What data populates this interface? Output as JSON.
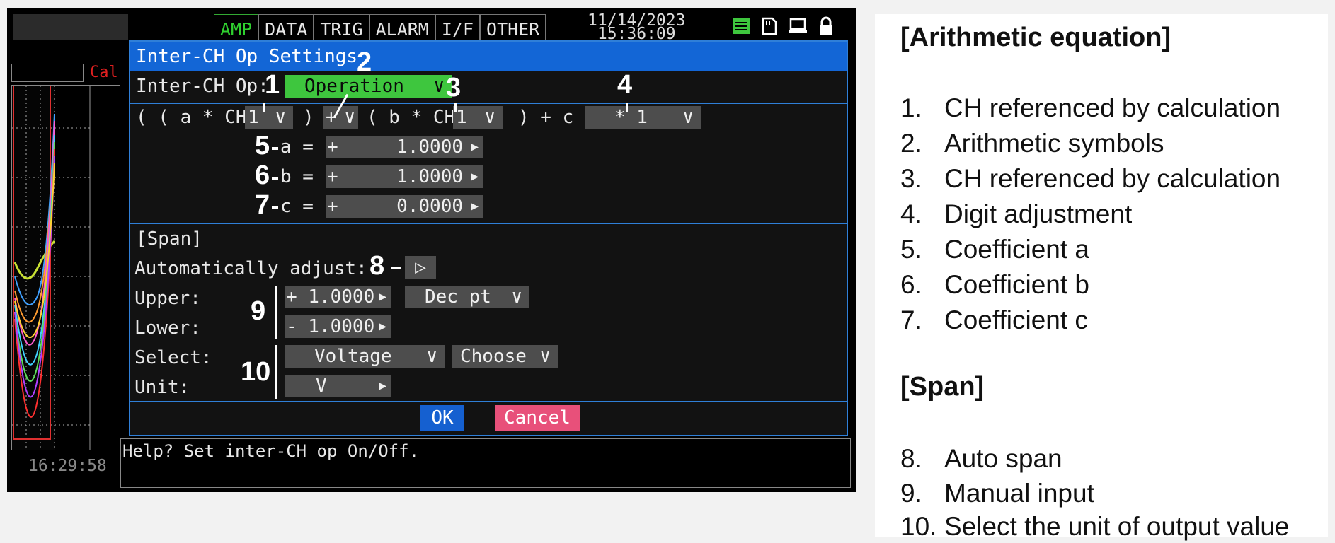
{
  "screen": {
    "tabs": [
      "AMP",
      "DATA",
      "TRIG",
      "ALARM",
      "I/F",
      "OTHER"
    ],
    "date": "11/14/2023",
    "time": "15:36:09",
    "icons": [
      "list-icon",
      "memory-card-icon",
      "pc-icon",
      "lock-icon"
    ],
    "cal_label": "Cal",
    "trace_time": "16:29:58",
    "help_text": "Help?  Set inter-CH op On/Off."
  },
  "dialog": {
    "title": "Inter-CH Op Settings",
    "op_label": "Inter-CH Op:",
    "op_value": "Operation",
    "eq": {
      "open": "( ( a * CH",
      "ch1": "1",
      "mid1": ")",
      "symbol": "+",
      "mid2": "( b * CH",
      "ch2": "1",
      "tail": ") + c )",
      "digit": "* 1"
    },
    "coef": [
      {
        "label": "a =",
        "sign": "+",
        "value": "1.0000"
      },
      {
        "label": "b =",
        "sign": "+",
        "value": "1.0000"
      },
      {
        "label": "c =",
        "sign": "+",
        "value": "0.0000"
      }
    ],
    "span": {
      "header": "[Span]",
      "auto_label": "Automatically adjust:",
      "auto_btn": "▷",
      "upper_label": "Upper:",
      "upper_value": "+ 1.0000",
      "dec_pt": "Dec pt",
      "lower_label": "Lower:",
      "lower_value": "- 1.0000",
      "select_label": "Select:",
      "select_value": "Voltage",
      "choose": "Choose",
      "unit_label": "Unit:",
      "unit_value": "V"
    },
    "ok": "OK",
    "cancel": "Cancel"
  },
  "markers": [
    "1",
    "2",
    "3",
    "4",
    "5",
    "6",
    "7",
    "8",
    "9",
    "10"
  ],
  "legend": {
    "eq_title": "[Arithmetic equation]",
    "eq_items": [
      {
        "n": "1.",
        "text": "CH referenced by calculation"
      },
      {
        "n": "2.",
        "text": "Arithmetic symbols"
      },
      {
        "n": "3.",
        "text": "CH referenced by calculation"
      },
      {
        "n": "4.",
        "text": "Digit adjustment"
      },
      {
        "n": "5.",
        "text": "Coefficient a"
      },
      {
        "n": "6.",
        "text": "Coefficient b"
      },
      {
        "n": "7.",
        "text": "Coefficient c"
      }
    ],
    "span_title": "[Span]",
    "span_items": [
      {
        "n": "8.",
        "text": "Auto span"
      },
      {
        "n": "9.",
        "text": "Manual input"
      },
      {
        "n": "10.",
        "text": "Select the unit of output value"
      }
    ]
  },
  "colors": {
    "dialog_border": "#2f7fd8",
    "title_bar": "#1366d6",
    "ok": "#1560d0",
    "cancel": "#e8507a",
    "green": "#3ec63e"
  }
}
